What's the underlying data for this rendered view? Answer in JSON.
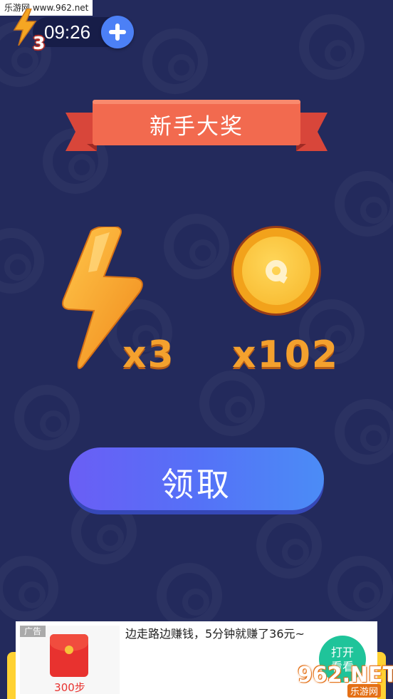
{
  "watermark": {
    "top_left": "乐游网 www.962.net",
    "logo_main": "962.NET",
    "logo_sub": "乐游网"
  },
  "status": {
    "energy_count": "3",
    "timer": "09:26"
  },
  "ribbon": {
    "title": "新手大奖"
  },
  "rewards": {
    "energy_qty": "x3",
    "coin_qty": "x102"
  },
  "claim": {
    "label": "领取"
  },
  "ad": {
    "tag": "广告",
    "steps": "300步",
    "text": "边走路边赚钱，5分钟就赚了36元~",
    "open_line1": "打开",
    "open_line2": "看看"
  },
  "colors": {
    "background": "#232a5c",
    "ribbon": "#f26a4f",
    "claim_gradient_start": "#6a5ef5",
    "claim_gradient_end": "#4b8cf6",
    "reward_text": "#f4a12e",
    "ad_button": "#1fc49a"
  },
  "icons": [
    "energy-bolt-icon",
    "plus-icon",
    "lightning-reward-icon",
    "coin-icon",
    "red-packet-icon"
  ]
}
